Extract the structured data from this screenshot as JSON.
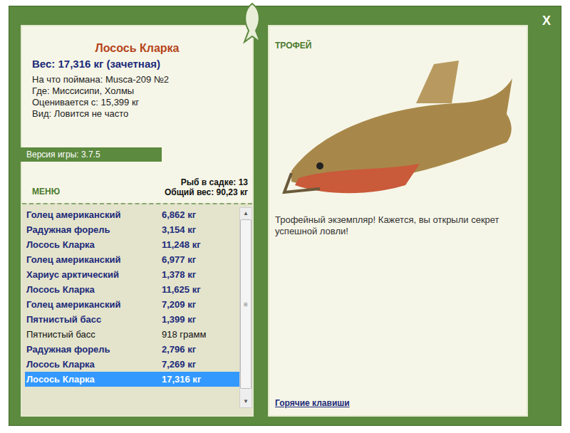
{
  "window": {
    "close": "X"
  },
  "catch": {
    "name": "Лосось Кларка",
    "weight": "Вес: 17,316 кг (зачетная)",
    "details": [
      "На что поймана: Musca-209 №2",
      "Где: Миссисипи, Холмы",
      "Оценивается с: 15,399 кг",
      "Вид: Ловится не часто"
    ]
  },
  "version": "Версия игры: 3.7.5",
  "menu": "МЕНЮ",
  "keepnet": {
    "count": "Рыб в садке: 13",
    "total": "Общий вес: 90,23 кг"
  },
  "fish_list": [
    {
      "name": "Голец американский",
      "weight": "6,862 кг",
      "bold": true,
      "selected": false
    },
    {
      "name": "Радужная форель",
      "weight": "3,154 кг",
      "bold": true,
      "selected": false
    },
    {
      "name": "Лосось Кларка",
      "weight": "11,248 кг",
      "bold": true,
      "selected": false
    },
    {
      "name": "Голец американский",
      "weight": "6,977 кг",
      "bold": true,
      "selected": false
    },
    {
      "name": "Хариус арктический",
      "weight": "1,378 кг",
      "bold": true,
      "selected": false
    },
    {
      "name": "Лосось Кларка",
      "weight": "11,625 кг",
      "bold": true,
      "selected": false
    },
    {
      "name": "Голец американский",
      "weight": "7,209 кг",
      "bold": true,
      "selected": false
    },
    {
      "name": "Пятнистый басс",
      "weight": "1,399 кг",
      "bold": true,
      "selected": false
    },
    {
      "name": "Пятнистый басс",
      "weight": "918 грамм",
      "bold": false,
      "selected": false
    },
    {
      "name": "Радужная форель",
      "weight": "2,796 кг",
      "bold": true,
      "selected": false
    },
    {
      "name": "Лосось Кларка",
      "weight": "7,269 кг",
      "bold": true,
      "selected": false
    },
    {
      "name": "Лосось Кларка",
      "weight": "17,316 кг",
      "bold": true,
      "selected": true
    }
  ],
  "scroll": {
    "up": "▲",
    "down": "▼",
    "grip": "≡",
    "level": 0.96
  },
  "trophy": {
    "label": "ТРОФЕЙ",
    "message": "Трофейный экземпляр! Кажется, вы открыли секрет успешной ловли!",
    "link": "Горячие клавиши"
  }
}
